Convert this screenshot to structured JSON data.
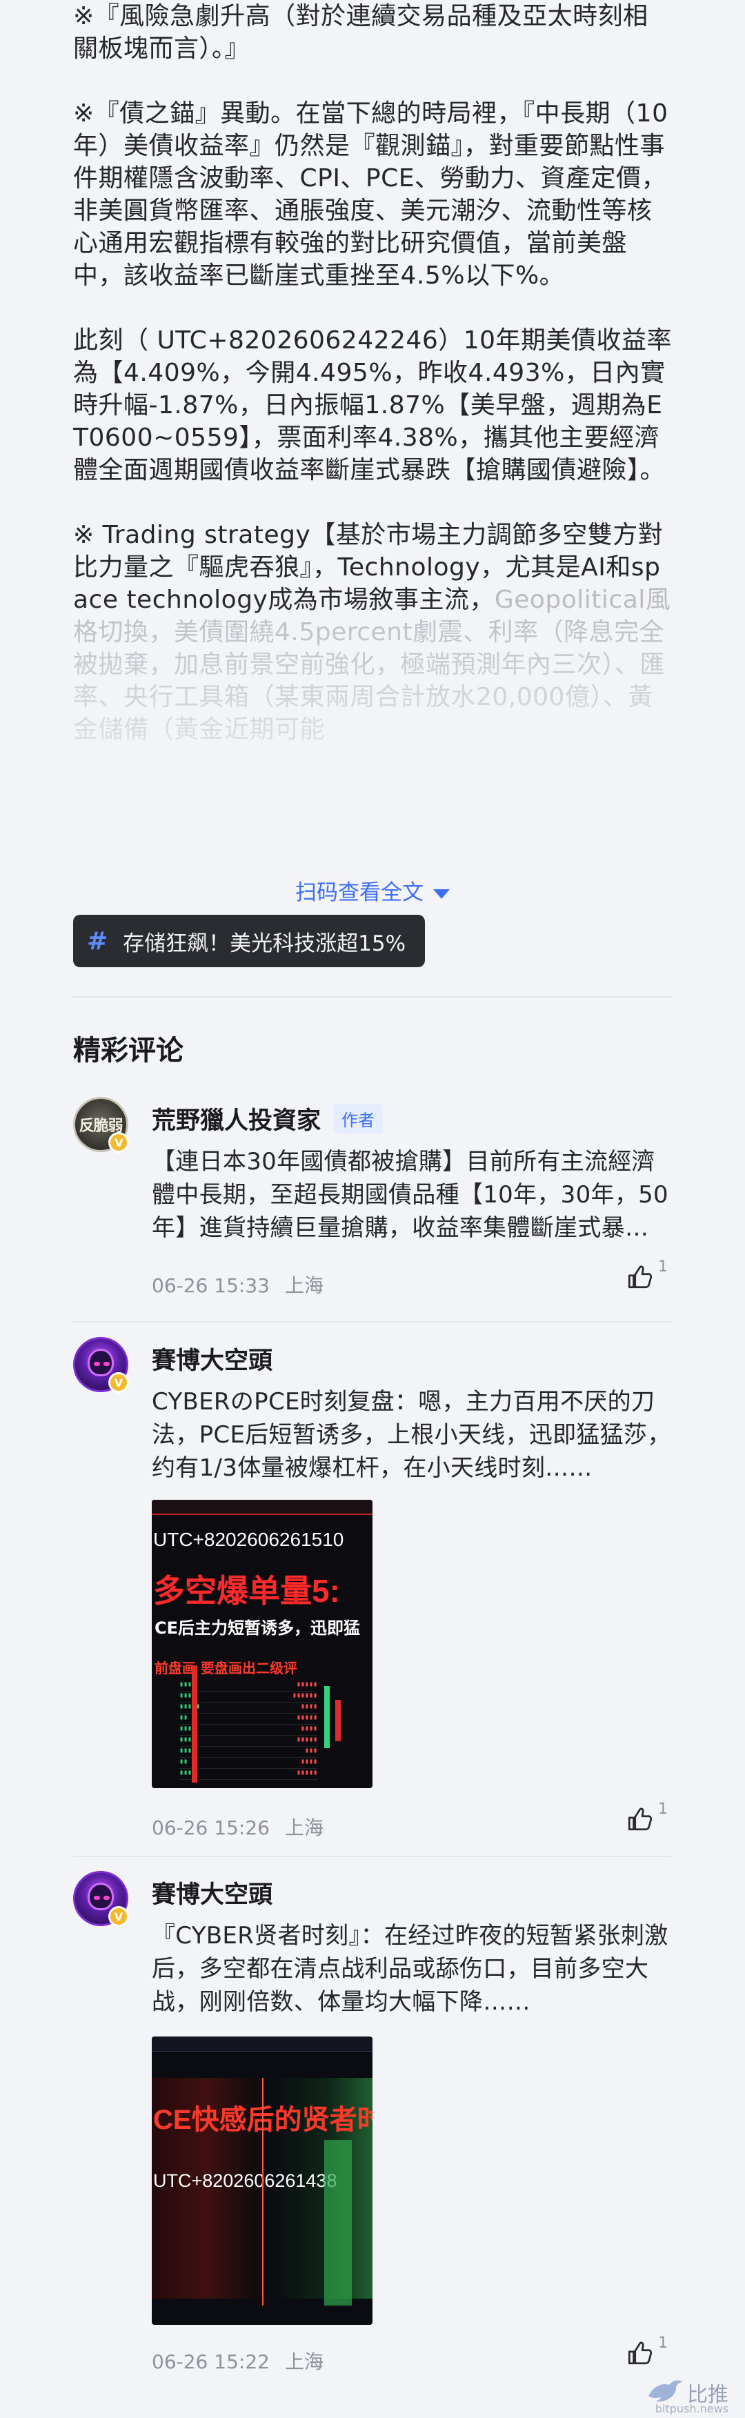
{
  "article": {
    "paragraphs": [
      "※『風險急劇升高（對於連續交易品種及亞太時刻相關板塊而言）。』",
      "※『債之錨』異動。在當下總的時局裡，『中長期（10年）美債收益率』仍然是『觀測錨』，對重要節點性事件期權隱含波動率、CPI、PCE、勞動力、資產定價，非美圓貨幣匯率、通脹強度、美元潮汐、流動性等核心通用宏觀指標有較強的對比研究價值，當前美盤中，該收益率已斷崖式重挫至4.5%以下%。",
      "此刻（ UTC+8202606242246）10年期美債收益率為【4.409%，今開4.495%，昨收4.493%，日內實時升幅-1.87%，日內振幅1.87%【美早盤，週期為ET0600~0559】，票面利率4.38%，攜其他主要經濟體全面週期國債收益率斷崖式暴跌【搶購國債避險】。"
    ],
    "fade_paragraph_head": "※ Trading strategy【基於市場主力調節多空雙方對比力量之『驅虎吞狼』，Technology，尤其是AI和space technology成為市場敘事主流，",
    "fade_paragraph_tail": "Geopolitical風格切換，美債圍繞4.5percent劇震、利率（降息完全被拋棄，加息前景空前強化，極端預測年內三次）、匯率、央行工具箱（某東兩周合計放水20,000億）、黃金儲備（黃金近期可能"
  },
  "read_more_label": "扫码查看全文",
  "topic_tag": "存储狂飙！美光科技涨超15%",
  "section_title": "精彩评论",
  "comments": [
    {
      "user": "荒野獵人投資家",
      "author_badge": "作者",
      "avatar_text": "反脆弱",
      "text": "【連日本30年國債都被搶購】目前所有主流經濟體中長期，至超長期國債品種【10年，30年，50年】進貨持續巨量搶購，收益率集體斷崖式暴跌……",
      "date": "06-26 15:33",
      "location": "上海",
      "likes": "1"
    },
    {
      "user": "賽博大空頭",
      "text": "CYBERのPCE时刻复盘：嗯，主力百用不厌的刀法，PCE后短暂诱多，上根小天线，迅即猛猛莎，约有1/3体量被爆杠杆，在小天线时刻……",
      "date": "06-26 15:26",
      "location": "上海",
      "likes": "1",
      "image": {
        "utc": "UTC+8202606261510",
        "big": "多空爆单量5:",
        "mid": "CE后主力短暂诱多，迅即猛",
        "mid2": "前盘画    要盘画出二级评"
      }
    },
    {
      "user": "賽博大空頭",
      "text": "『CYBER贤者时刻』：在经过昨夜的短暂紧张刺激后，多空都在清点战利品或舔伤口，目前多空大战，刚刚倍数、体量均大幅下降……",
      "date": "06-26 15:22",
      "location": "上海",
      "likes": "1",
      "image": {
        "big": "CE快感后的贤者时",
        "utc": "UTC+8202606261438"
      }
    }
  ],
  "watermark": {
    "name": "比推",
    "site": "bitpush.news"
  }
}
